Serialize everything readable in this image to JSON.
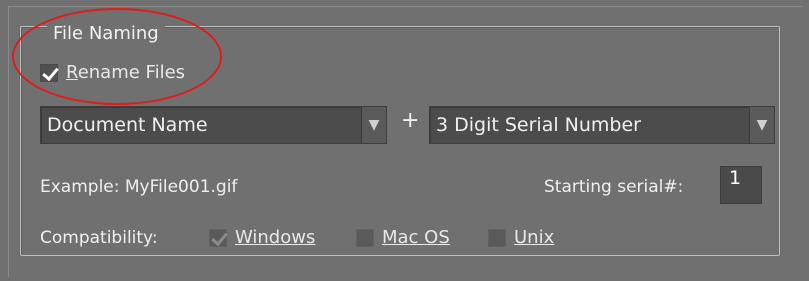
{
  "group": {
    "title": "File Naming",
    "rename_files": {
      "label": "Rename Files",
      "checked": true
    }
  },
  "naming": {
    "part1": {
      "value": "Document Name"
    },
    "plus": "+",
    "part2": {
      "value": "3 Digit Serial Number"
    }
  },
  "example": "Example: MyFile001.gif",
  "serial": {
    "label": "Starting serial#:",
    "value": "1"
  },
  "compatibility": {
    "label": "Compatibility:",
    "windows": {
      "label": "Windows",
      "checked": true
    },
    "macos": {
      "label": "Mac OS",
      "checked": false
    },
    "unix": {
      "label": "Unix",
      "checked": false
    }
  },
  "colors": {
    "background": "#707070",
    "annotation_circle": "#e01b1b"
  }
}
